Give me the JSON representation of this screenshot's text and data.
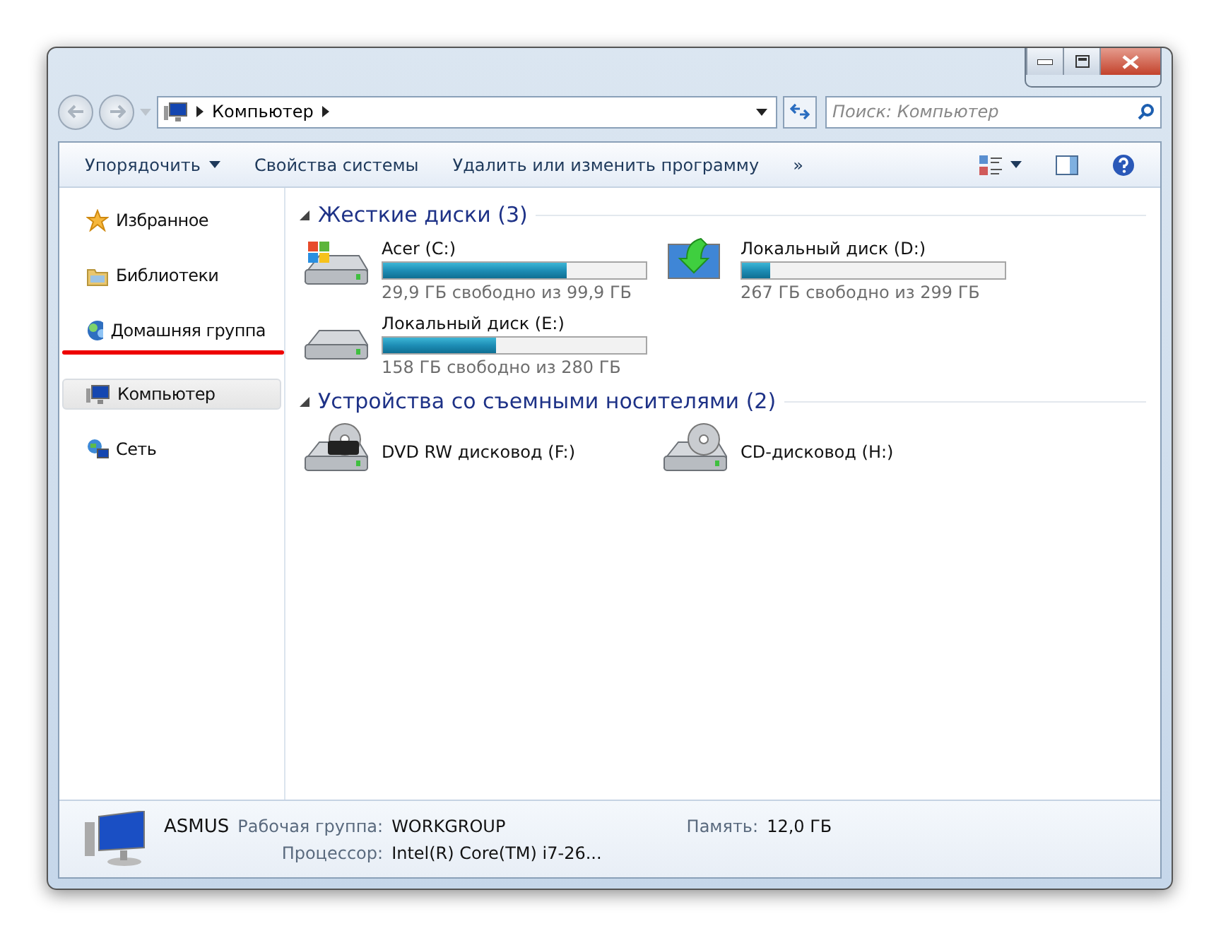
{
  "address": {
    "crumbs": [
      "Компьютер"
    ]
  },
  "search": {
    "placeholder": "Поиск: Компьютер"
  },
  "toolbar": {
    "items": [
      "Упорядочить",
      "Свойства системы",
      "Удалить или изменить программу"
    ],
    "overflow": "»"
  },
  "sidebar": {
    "items": [
      {
        "label": "Избранное",
        "kind": "star",
        "selected": false,
        "underlined": false
      },
      {
        "label": "Библиотеки",
        "kind": "folder",
        "selected": false,
        "underlined": false
      },
      {
        "label": "Домашняя группа",
        "kind": "homegroup",
        "selected": false,
        "underlined": true
      },
      {
        "label": "Компьютер",
        "kind": "computer",
        "selected": true,
        "underlined": false
      },
      {
        "label": "Сеть",
        "kind": "network",
        "selected": false,
        "underlined": false
      }
    ]
  },
  "groups": [
    {
      "title": "Жесткие диски (3)",
      "items": [
        {
          "name": "Acer (C:)",
          "kind": "system",
          "level": 0.7,
          "free": "29,9 ГБ свободно из 99,9 ГБ"
        },
        {
          "name": "Локальный диск (D:)",
          "kind": "download",
          "level": 0.11,
          "free": "267 ГБ свободно из 299 ГБ"
        },
        {
          "name": "Локальный диск (E:)",
          "kind": "local",
          "level": 0.43,
          "free": "158 ГБ свободно из 280 ГБ"
        }
      ]
    },
    {
      "title": "Устройства со съемными носителями (2)",
      "items": [
        {
          "name": "DVD RW дисковод (F:)",
          "kind": "dvd"
        },
        {
          "name": "CD-дисковод (H:)",
          "kind": "cd"
        }
      ]
    }
  ],
  "status": {
    "name": "ASMUS",
    "fields": [
      {
        "label": "Рабочая группа:",
        "value": "WORKGROUP"
      },
      {
        "label": "Память:",
        "value": "12,0 ГБ"
      },
      {
        "label": "Процессор:",
        "value": "Intel(R) Core(TM) i7-26..."
      }
    ]
  }
}
